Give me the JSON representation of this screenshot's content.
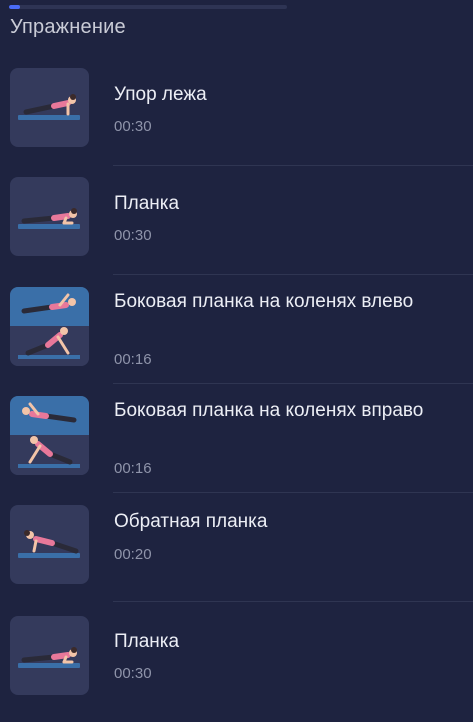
{
  "header": {
    "section_title": "Упражнение",
    "progress": 0.04
  },
  "exercises": [
    {
      "name": "Упор лежа",
      "duration": "00:30",
      "icon": "pushup-illustration-icon"
    },
    {
      "name": "Планка",
      "duration": "00:30",
      "icon": "plank-illustration-icon"
    },
    {
      "name": "Боковая планка на коленях влево",
      "duration": "00:16",
      "icon": "side-plank-left-illustration-icon"
    },
    {
      "name": "Боковая планка на коленях вправо",
      "duration": "00:16",
      "icon": "side-plank-right-illustration-icon"
    },
    {
      "name": "Обратная планка",
      "duration": "00:20",
      "icon": "reverse-plank-illustration-icon"
    },
    {
      "name": "Планка",
      "duration": "00:30",
      "icon": "plank-illustration-icon"
    }
  ],
  "colors": {
    "background": "#1e2340",
    "thumb_background": "#343a5c",
    "mat": "#3a6fa8",
    "accent": "#e8789a",
    "progress": "#4a6cf7"
  }
}
